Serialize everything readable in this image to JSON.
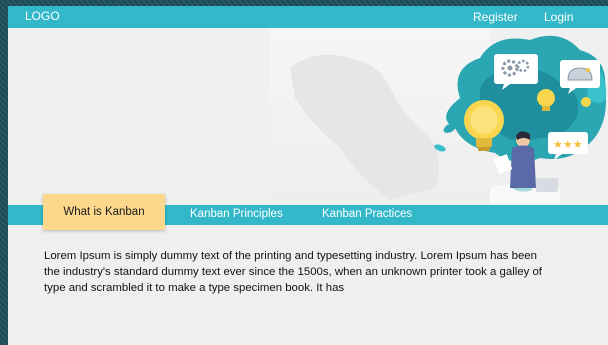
{
  "header": {
    "logo": "LOGO",
    "register": "Register",
    "login": "Login"
  },
  "tabs": {
    "active": "What is Kanban",
    "principles": "Kanban Principles",
    "practices": "Kanban Practices"
  },
  "content": {
    "paragraph": "Lorem Ipsum is simply dummy text of the printing and typesetting industry. Lorem Ipsum has been the industry's standard dummy text ever since the 1500s, when an unknown printer took a galley of type and scrambled it to make a type specimen book. It has"
  },
  "colors": {
    "accent": "#32b8c9",
    "active_tab": "#fcd88c",
    "hero_bg": "#f0f0f0"
  },
  "icons": [
    "gear-icon",
    "lightbulb-icon",
    "brain-icon",
    "star-icon"
  ]
}
